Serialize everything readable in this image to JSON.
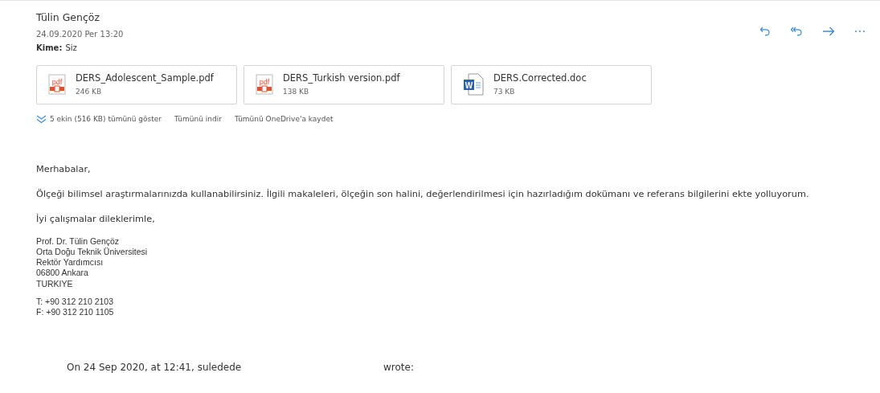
{
  "sender": {
    "name": "Tülin Gençöz",
    "date": "24.09.2020 Per 13:20",
    "to_label": "Kime:",
    "to_value": "Siz"
  },
  "attachments": [
    {
      "kind": "pdf",
      "icon_label": "pdf",
      "name": "DERS_Adolescent_Sample.pdf",
      "size": "246 KB"
    },
    {
      "kind": "pdf",
      "icon_label": "pdf",
      "name": "DERS_Turkish version.pdf",
      "size": "138 KB"
    },
    {
      "kind": "word",
      "icon_label": "W",
      "name": "DERS.Corrected.doc",
      "size": "73 KB"
    }
  ],
  "attachment_actions": {
    "show_all": "5 ekin (516 KB) tümünü göster",
    "download_all": "Tümünü indir",
    "save_all": "Tümünü OneDrive'a kaydet"
  },
  "body": {
    "greeting": "Merhabalar,",
    "paragraph": "Ölçeği bilimsel araştırmalarınızda kullanabilirsiniz. İlgili makaleleri, ölçeğin son halini, değerlendirilmesi için hazırladığım dokümanı ve referans bilgilerini ekte yolluyorum.",
    "closing": "İyi çalışmalar dileklerimle,",
    "signature": [
      "Prof. Dr. Tülin Gençöz",
      "Orta Doğu Teknik Üniversitesi",
      "Rektör Yardımcısı",
      "06800 Ankara",
      "TURKIYE"
    ],
    "contacts": [
      "T: +90 312 210 2103",
      "F: +90 312 210 1105"
    ]
  },
  "quote": {
    "intro": "On 24 Sep 2020, at 12:41, suledede",
    "wrote": "wrote:"
  }
}
